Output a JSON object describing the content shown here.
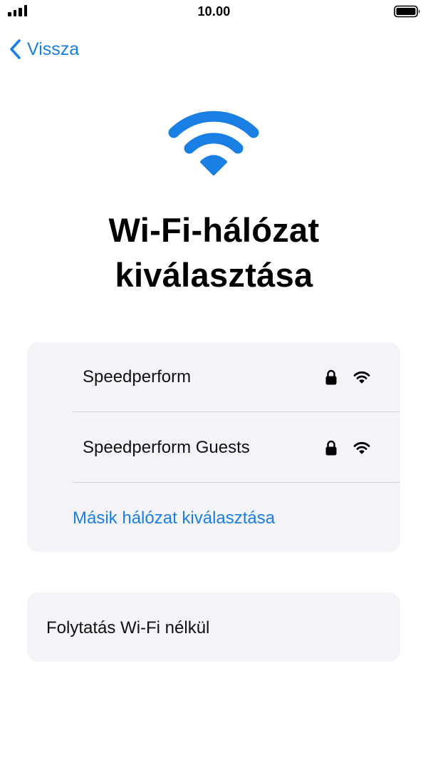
{
  "status_bar": {
    "time": "10.00",
    "signal_icon": "cellular-signal-icon",
    "battery_icon": "battery-full-icon"
  },
  "nav": {
    "back_label": "Vissza",
    "back_icon": "chevron-left-icon"
  },
  "hero": {
    "icon": "wifi-icon",
    "title_line1": "Wi-Fi-hálózat",
    "title_line2": "kiválasztása"
  },
  "networks": [
    {
      "name": "Speedperform",
      "secured": true,
      "lock_icon": "lock-icon",
      "signal_icon": "wifi-signal-icon"
    },
    {
      "name": "Speedperform Guests",
      "secured": true,
      "lock_icon": "lock-icon",
      "signal_icon": "wifi-signal-icon"
    }
  ],
  "other_network_label": "Másik hálózat kiválasztása",
  "continue_without_wifi_label": "Folytatás Wi-Fi nélkül",
  "colors": {
    "accent": "#1a7fe3",
    "card_background": "#f3f3f8",
    "divider": "#d6d6dc",
    "text": "#111111"
  }
}
